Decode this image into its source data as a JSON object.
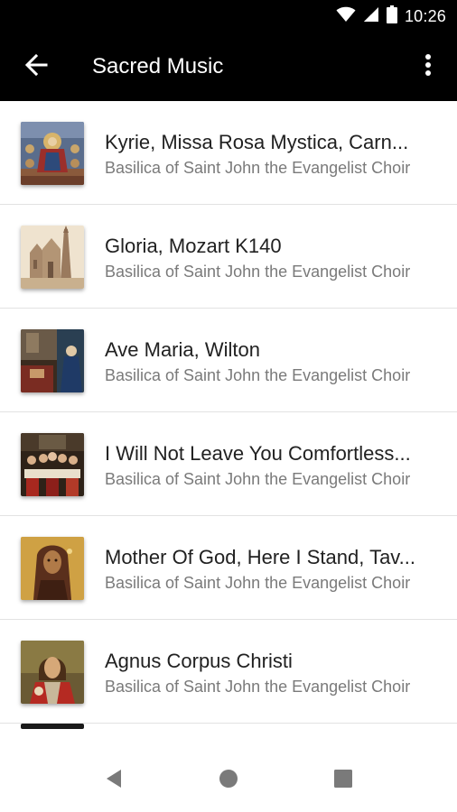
{
  "status_bar": {
    "time": "10:26",
    "icons": [
      "wifi-icon",
      "signal-icon",
      "battery-icon"
    ]
  },
  "app_bar": {
    "title": "Sacred Music",
    "back_icon": "arrow-back-icon",
    "menu_icon": "more-vert-icon"
  },
  "tracks": [
    {
      "title": "Kyrie, Missa Rosa Mystica, Carn...",
      "subtitle": "Basilica of Saint John the Evangelist Choir",
      "artwork": "madonna-enthroned-painting"
    },
    {
      "title": "Gloria, Mozart K140",
      "subtitle": "Basilica of Saint John the Evangelist Choir",
      "artwork": "cathedral-illustration"
    },
    {
      "title": "Ave Maria, Wilton",
      "subtitle": "Basilica of Saint John the Evangelist Choir",
      "artwork": "annunciation-painting"
    },
    {
      "title": "I Will Not Leave You Comfortless...",
      "subtitle": "Basilica of Saint John the Evangelist Choir",
      "artwork": "last-supper-painting"
    },
    {
      "title": "Mother Of God, Here I Stand, Tav...",
      "subtitle": "Basilica of Saint John the Evangelist Choir",
      "artwork": "madonna-icon-painting"
    },
    {
      "title": "Agnus Corpus Christi",
      "subtitle": "Basilica of Saint John the Evangelist Choir",
      "artwork": "christ-portrait-painting"
    }
  ],
  "nav_bar": {
    "icons": [
      "back-triangle-icon",
      "home-circle-icon",
      "recents-square-icon"
    ]
  }
}
